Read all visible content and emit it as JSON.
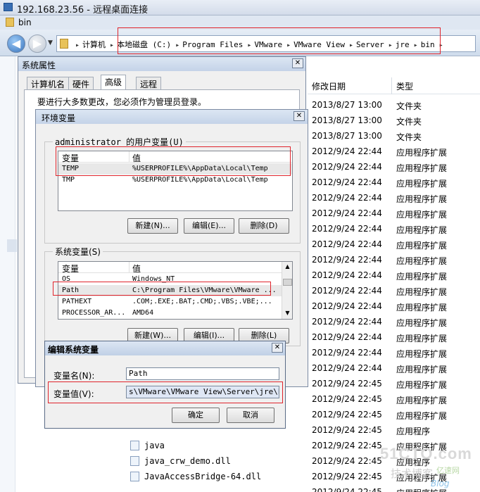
{
  "rdp": {
    "title": "192.168.23.56 - 远程桌面连接"
  },
  "explorer": {
    "title": "bin",
    "breadcrumb": [
      "计算机",
      "本地磁盘 (C:)",
      "Program Files",
      "VMware",
      "VMware View",
      "Server",
      "jre",
      "bin"
    ],
    "columns": {
      "date": "修改日期",
      "type": "类型"
    },
    "rows": [
      {
        "date": "2013/8/27 13:00",
        "type": "文件夹"
      },
      {
        "date": "2013/8/27 13:00",
        "type": "文件夹"
      },
      {
        "date": "2013/8/27 13:00",
        "type": "文件夹"
      },
      {
        "date": "2012/9/24 22:44",
        "type": "应用程序扩展"
      },
      {
        "date": "2012/9/24 22:44",
        "type": "应用程序扩展"
      },
      {
        "date": "2012/9/24 22:44",
        "type": "应用程序扩展"
      },
      {
        "date": "2012/9/24 22:44",
        "type": "应用程序扩展"
      },
      {
        "date": "2012/9/24 22:44",
        "type": "应用程序扩展"
      },
      {
        "date": "2012/9/24 22:44",
        "type": "应用程序扩展"
      },
      {
        "date": "2012/9/24 22:44",
        "type": "应用程序扩展"
      },
      {
        "date": "2012/9/24 22:44",
        "type": "应用程序扩展"
      },
      {
        "date": "2012/9/24 22:44",
        "type": "应用程序扩展"
      },
      {
        "date": "2012/9/24 22:44",
        "type": "应用程序扩展"
      },
      {
        "date": "2012/9/24 22:44",
        "type": "应用程序扩展"
      },
      {
        "date": "2012/9/24 22:44",
        "type": "应用程序扩展"
      },
      {
        "date": "2012/9/24 22:44",
        "type": "应用程序扩展"
      },
      {
        "date": "2012/9/24 22:44",
        "type": "应用程序扩展"
      },
      {
        "date": "2012/9/24 22:44",
        "type": "应用程序扩展"
      },
      {
        "date": "2012/9/24 22:45",
        "type": "应用程序扩展"
      },
      {
        "date": "2012/9/24 22:45",
        "type": "应用程序扩展"
      },
      {
        "date": "2012/9/24 22:45",
        "type": "应用程序扩展"
      },
      {
        "date": "2012/9/24 22:45",
        "type": "应用程序"
      },
      {
        "date": "2012/9/24 22:45",
        "type": "应用程序扩展"
      },
      {
        "date": "2012/9/24 22:45",
        "type": "应用程序"
      },
      {
        "date": "2012/9/24 22:45",
        "type": "应用程序扩展"
      },
      {
        "date": "2012/9/24 22:45",
        "type": "应用程序扩展"
      }
    ],
    "bottom_files": [
      "java",
      "java_crw_demo.dll",
      "JavaAccessBridge-64.dll"
    ]
  },
  "sysprops": {
    "title": "系统属性",
    "tabs": [
      "计算机名",
      "硬件",
      "高级",
      "远程"
    ],
    "admin_note": "要进行大多数更改，您必须作为管理员登录。"
  },
  "envvars": {
    "title": "环境变量",
    "user_group": "administrator 的用户变量(U)",
    "user_headers": {
      "var": "变量",
      "val": "值"
    },
    "user_rows": [
      {
        "var": "TEMP",
        "val": "%USERPROFILE%\\AppData\\Local\\Temp"
      },
      {
        "var": "TMP",
        "val": "%USERPROFILE%\\AppData\\Local\\Temp"
      }
    ],
    "user_buttons": {
      "new": "新建(N)...",
      "edit": "编辑(E)...",
      "delete": "删除(D)"
    },
    "sys_group": "系统变量(S)",
    "sys_headers": {
      "var": "变量",
      "val": "值"
    },
    "sys_rows": [
      {
        "var": "OS",
        "val": "Windows_NT"
      },
      {
        "var": "Path",
        "val": "C:\\Program Files\\VMware\\VMware ..."
      },
      {
        "var": "PATHEXT",
        "val": ".COM;.EXE;.BAT;.CMD;.VBS;.VBE;..."
      },
      {
        "var": "PROCESSOR_AR...",
        "val": "AMD64"
      }
    ],
    "sys_buttons": {
      "new": "新建(W)...",
      "edit": "编辑(I)...",
      "delete": "删除(L)"
    }
  },
  "editvar": {
    "title": "编辑系统变量",
    "name_label": "变量名(N):",
    "name_value": "Path",
    "value_label": "变量值(V):",
    "value_value": "s\\VMware\\VMware View\\Server\\jre\\bin",
    "ok": "确定",
    "cancel": "取消"
  },
  "watermark": {
    "site": "51CTO.com",
    "tag": "技术博客",
    "brand": "亿速网",
    "blog": "Blog"
  },
  "colors": {
    "highlight": "#e0242c",
    "titlebar": "#c4d3e8"
  }
}
